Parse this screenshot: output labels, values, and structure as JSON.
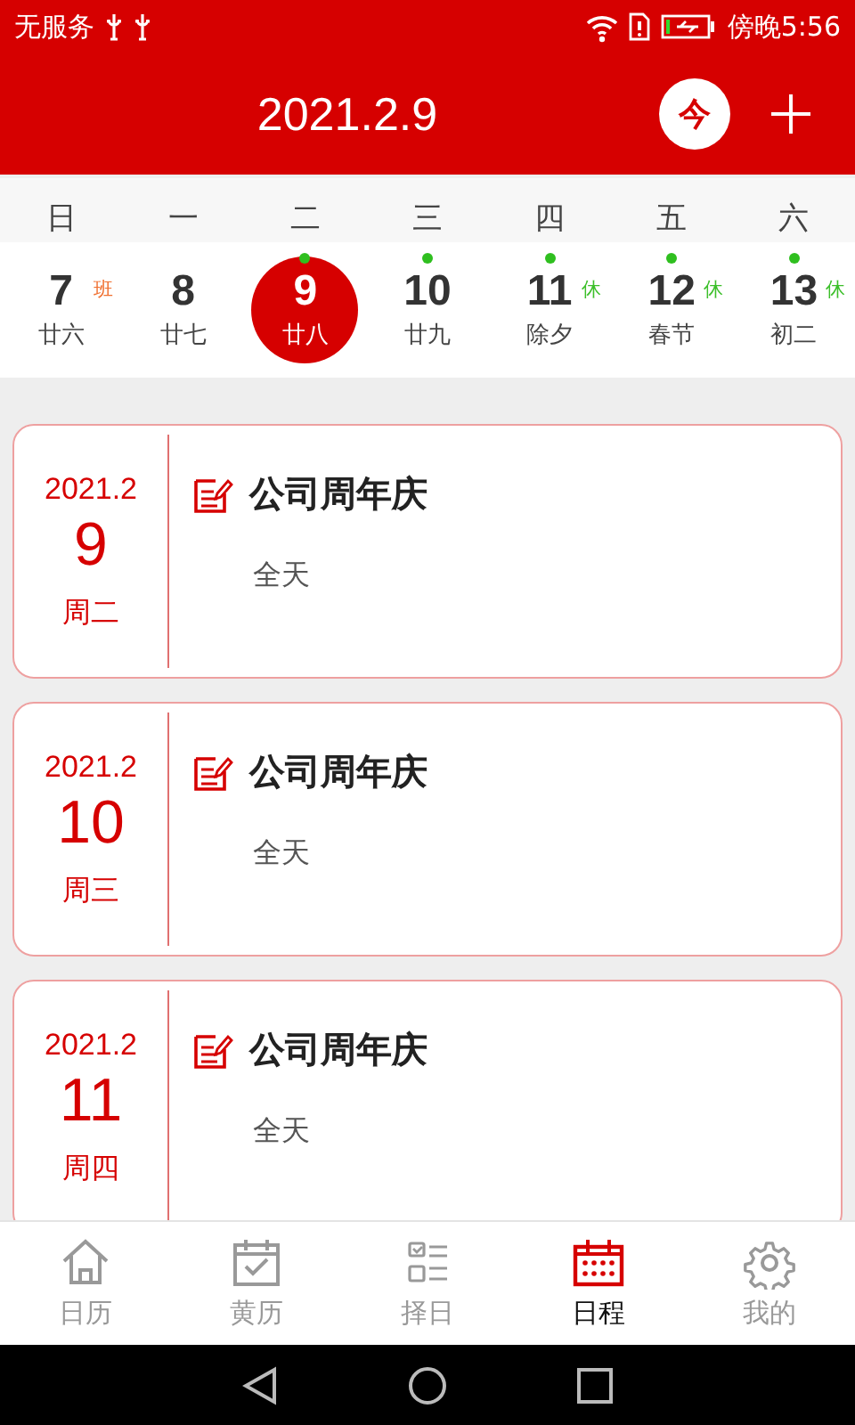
{
  "status_bar": {
    "carrier": "无服务",
    "time": "傍晚5:56"
  },
  "header": {
    "title": "2021.2.9",
    "today_button": "今"
  },
  "weekdays": [
    "日",
    "一",
    "二",
    "三",
    "四",
    "五",
    "六"
  ],
  "days": [
    {
      "day": "7",
      "lunar": "廿六",
      "badge": {
        "text": "班",
        "kind": "work"
      },
      "has_event": false,
      "selected": false
    },
    {
      "day": "8",
      "lunar": "廿七",
      "has_event": false,
      "selected": false
    },
    {
      "day": "9",
      "lunar": "廿八",
      "has_event": true,
      "selected": true
    },
    {
      "day": "10",
      "lunar": "廿九",
      "has_event": true,
      "selected": false
    },
    {
      "day": "11",
      "lunar": "除夕",
      "badge": {
        "text": "休",
        "kind": "rest"
      },
      "has_event": true,
      "selected": false
    },
    {
      "day": "12",
      "lunar": "春节",
      "badge": {
        "text": "休",
        "kind": "rest"
      },
      "has_event": true,
      "selected": false
    },
    {
      "day": "13",
      "lunar": "初二",
      "badge": {
        "text": "休",
        "kind": "rest"
      },
      "has_event": true,
      "selected": false
    }
  ],
  "events": [
    {
      "year_month": "2021.2",
      "day": "9",
      "weekday": "周二",
      "title": "公司周年庆",
      "time": "全天"
    },
    {
      "year_month": "2021.2",
      "day": "10",
      "weekday": "周三",
      "title": "公司周年庆",
      "time": "全天"
    },
    {
      "year_month": "2021.2",
      "day": "11",
      "weekday": "周四",
      "title": "公司周年庆",
      "time": "全天"
    }
  ],
  "tabs": [
    {
      "label": "日历",
      "kind": "home",
      "selected": false
    },
    {
      "label": "黄历",
      "kind": "check",
      "selected": false
    },
    {
      "label": "择日",
      "kind": "list",
      "selected": false
    },
    {
      "label": "日程",
      "kind": "calendar",
      "selected": true
    },
    {
      "label": "我的",
      "kind": "gear",
      "selected": false
    }
  ]
}
